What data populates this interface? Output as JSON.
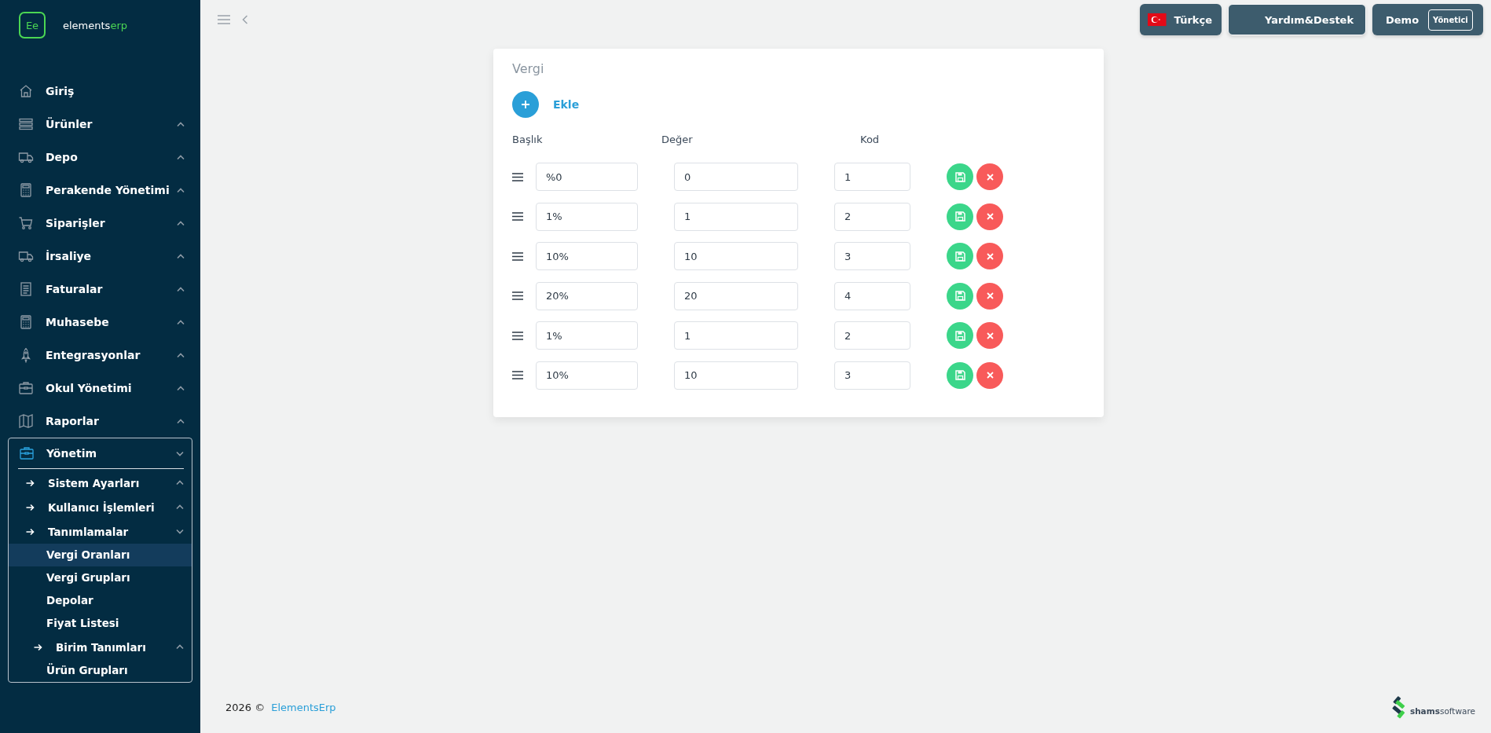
{
  "sidebar": {
    "logo": {
      "mark": "Ee",
      "name": "elements",
      "accent": "erp"
    },
    "menu": [
      {
        "label": "Giriş"
      },
      {
        "label": "Ürünler",
        "expanded": false
      },
      {
        "label": "Depo",
        "expanded": false
      },
      {
        "label": "Perakende Yönetimi",
        "expanded": false
      },
      {
        "label": "Siparişler",
        "expanded": false
      },
      {
        "label": "İrsaliye",
        "expanded": false
      },
      {
        "label": "Faturalar",
        "expanded": false
      },
      {
        "label": "Muhasebe",
        "expanded": false
      },
      {
        "label": "Entegrasyonlar",
        "expanded": false
      },
      {
        "label": "Okul Yönetimi",
        "expanded": false
      },
      {
        "label": "Raporlar",
        "expanded": false
      },
      {
        "label": "Yönetim",
        "expanded": true,
        "children": [
          {
            "label": "Sistem Ayarları",
            "expanded": false
          },
          {
            "label": "Kullanıcı İşlemleri",
            "expanded": false
          },
          {
            "label": "Tanımlamalar",
            "expanded": true,
            "children": [
              {
                "label": "Vergi Oranları",
                "selected": true
              },
              {
                "label": "Vergi Grupları",
                "selected": false
              },
              {
                "label": "Depolar",
                "selected": false
              },
              {
                "label": "Fiyat Listesi",
                "selected": false
              },
              {
                "label": "Birim Tanımları",
                "expanded": false
              },
              {
                "label": "Ürün Grupları",
                "selected": false
              }
            ]
          }
        ]
      }
    ]
  },
  "topbar": {
    "language": "Türkçe",
    "help": "Yardım&Destek",
    "user": {
      "name": "Demo",
      "role": "Yönetici"
    }
  },
  "card": {
    "title": "Vergi",
    "add_label": "Ekle",
    "columns": [
      "Başlık",
      "Değer",
      "Kod"
    ],
    "rows": [
      {
        "title": "%0",
        "value": "0",
        "code": "1"
      },
      {
        "title": "1%",
        "value": "1",
        "code": "2"
      },
      {
        "title": "10%",
        "value": "10",
        "code": "3"
      },
      {
        "title": "20%",
        "value": "20",
        "code": "4"
      },
      {
        "title": "1%",
        "value": "1",
        "code": "2"
      },
      {
        "title": "10%",
        "value": "10",
        "code": "3"
      }
    ]
  },
  "footer": {
    "year": "2026 ©",
    "link": "ElementsErp",
    "brand": {
      "name": "shams",
      "accent": "software"
    }
  }
}
